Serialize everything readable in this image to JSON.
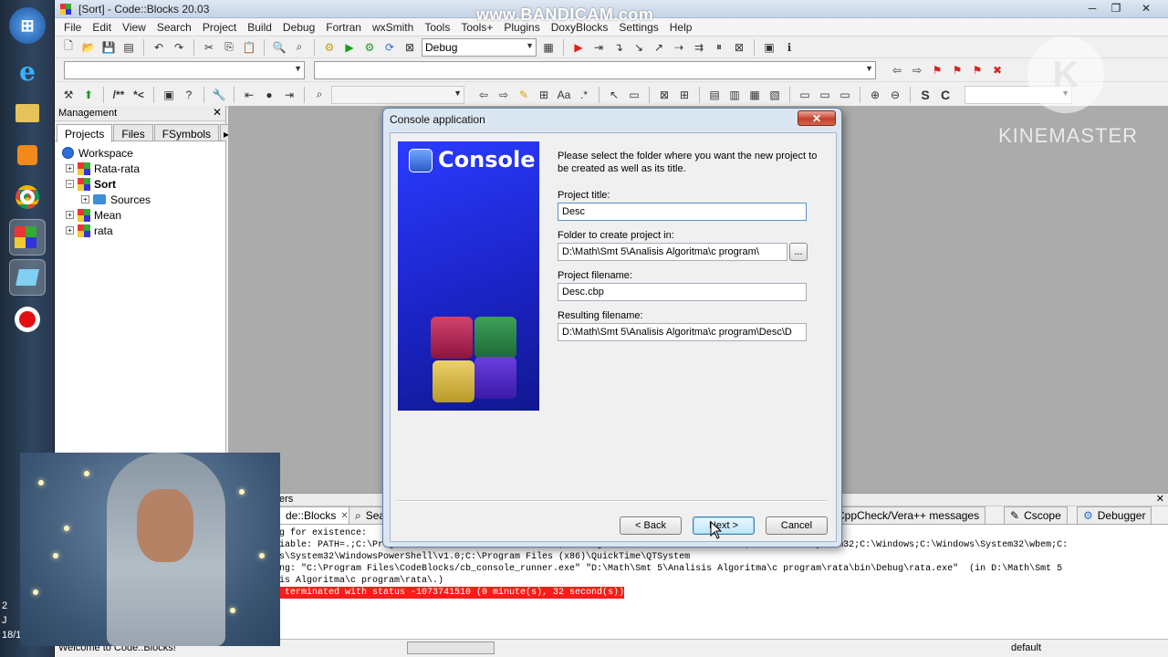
{
  "watermarks": {
    "bandicam": "www.BANDICAM.com",
    "kinemaster": "KINEMASTER",
    "kinemaster_logo": "K"
  },
  "window": {
    "title": "[Sort] - Code::Blocks 20.03"
  },
  "menu": [
    "File",
    "Edit",
    "View",
    "Search",
    "Project",
    "Build",
    "Debug",
    "Fortran",
    "wxSmith",
    "Tools",
    "Tools+",
    "Plugins",
    "DoxyBlocks",
    "Settings",
    "Help"
  ],
  "toolbar": {
    "build_target": "Debug"
  },
  "management": {
    "title": "Management",
    "tabs": [
      "Projects",
      "Files",
      "FSymbols"
    ],
    "tree": {
      "workspace": "Workspace",
      "projects": [
        {
          "label": "Rata-rata",
          "bold": false
        },
        {
          "label": "Sort",
          "bold": true,
          "children": [
            "Sources"
          ]
        },
        {
          "label": "Mean",
          "bold": false
        },
        {
          "label": "rata",
          "bold": false
        }
      ]
    }
  },
  "log": {
    "title": "ers",
    "tabs": [
      "de::Blocks",
      "Sea",
      "CppCheck/Vera++ messages",
      "Cscope",
      "Debugger"
    ],
    "lines": [
      "g for existence:",
      "iable: PATH=.;C:\\Program Files\\CodeBlocks\\MinGW\\bin;C:\\Program Files\\CodeBlocks\\MinGW;C:\\Windows\\System32;C:\\Windows;C:\\Windows\\System32\\wbem;C:",
      "s\\System32\\WindowsPowerShell\\v1.0;C:\\Program Files (x86)\\QuickTime\\QTSystem",
      "ng: \"C:\\Program Files\\CodeBlocks/cb_console_runner.exe\" \"D:\\Math\\Smt 5\\Analisis Algoritma\\c program\\rata\\bin\\Debug\\rata.exe\"  (in D:\\Math\\Smt 5",
      "is Algoritma\\c program\\rata\\.)"
    ],
    "error_line": " terminated with status -1073741510 (0 minute(s), 32 second(s))"
  },
  "status": {
    "welcome": "Welcome to Code::Blocks!",
    "default": "default"
  },
  "taskbar": {
    "clock_lines": [
      "2",
      "J",
      "18/1"
    ]
  },
  "dialog": {
    "title": "Console application",
    "close_label": "✕",
    "banner": "Console",
    "description": "Please select the folder where you want the new project to be created as well as its title.",
    "project_title_label": "Project title:",
    "project_title_value": "Desc",
    "folder_label": "Folder to create project in:",
    "folder_value": "D:\\Math\\Smt 5\\Analisis Algoritma\\c program\\",
    "browse_label": "...",
    "filename_label": "Project filename:",
    "filename_value": "Desc.cbp",
    "resulting_label": "Resulting filename:",
    "resulting_value": "D:\\Math\\Smt 5\\Analisis Algoritma\\c program\\Desc\\D",
    "back_label": "< Back",
    "next_label": "Next >",
    "cancel_label": "Cancel"
  }
}
